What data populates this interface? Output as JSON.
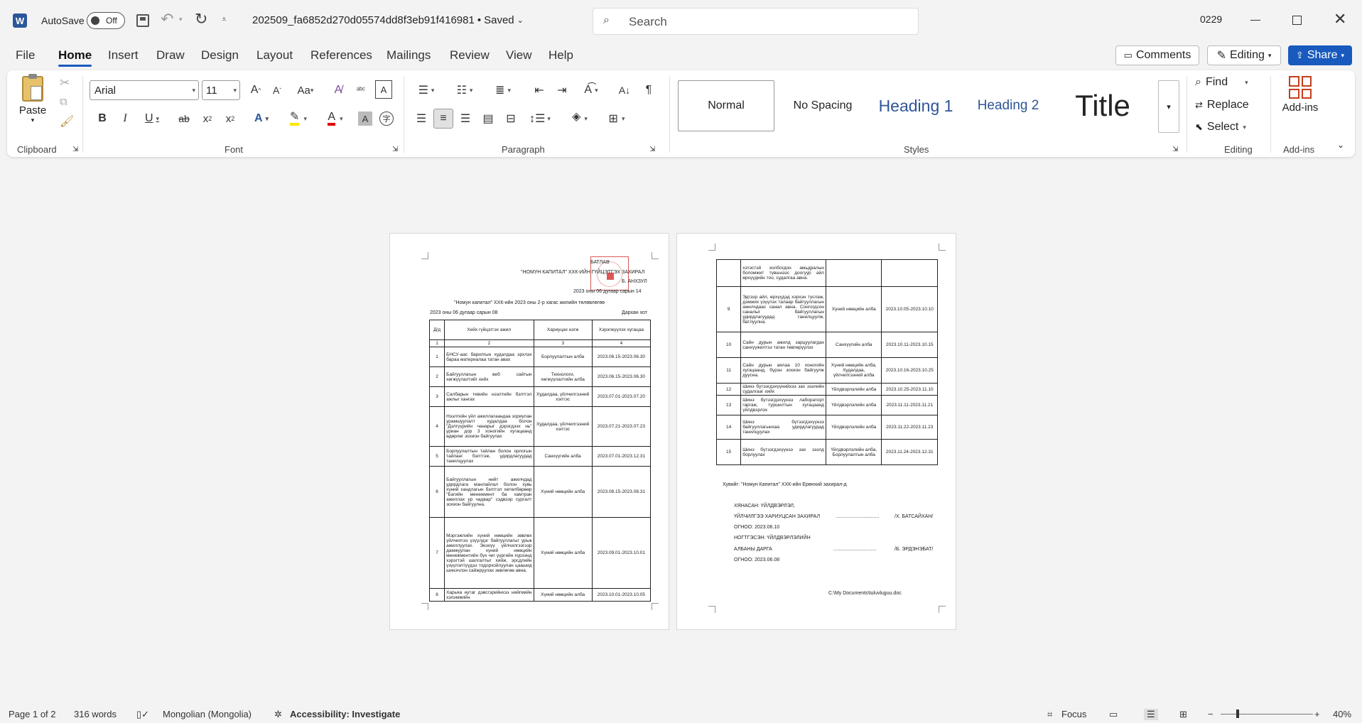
{
  "app": {
    "autosave": "AutoSave",
    "autosave_state": "Off",
    "filename": "202509_fa6852d270d05574dd8f3eb91f416981",
    "saved": "Saved",
    "search_placeholder": "Search",
    "user": "0229"
  },
  "tabs": [
    "File",
    "Home",
    "Insert",
    "Draw",
    "Design",
    "Layout",
    "References",
    "Mailings",
    "Review",
    "View",
    "Help"
  ],
  "right_buttons": {
    "comments": "Comments",
    "editing": "Editing",
    "share": "Share"
  },
  "ribbon": {
    "clipboard": {
      "paste": "Paste",
      "label": "Clipboard"
    },
    "font": {
      "name": "Arial",
      "size": "11",
      "label": "Font"
    },
    "paragraph": {
      "label": "Paragraph"
    },
    "styles": {
      "items": [
        "Normal",
        "No Spacing",
        "Heading 1",
        "Heading 2",
        "Title"
      ],
      "label": "Styles"
    },
    "editing": {
      "find": "Find",
      "replace": "Replace",
      "select": "Select",
      "label": "Editing"
    },
    "addins": {
      "btn": "Add-ins",
      "label": "Add-ins"
    }
  },
  "page1": {
    "approve": "БАТЛАВ",
    "approve_line2": "\"НОМУН КАПИТАЛ\" ХХК-ИЙН ГҮЙЦЭТГЭХ ЗАХИРАЛ",
    "approve_line3": "Б. АНХЗУЛ",
    "approve_date": "2023 оны 06 дугаар сарын 14",
    "title": "\"Номун капитал\" ХХК-ийн 2023 оны 2-р хагас жилийн төлөвлөгөө",
    "date_left": "2023 оны 06 дугаар сарын 08",
    "city": "Дархан хот",
    "headers": [
      "Д/д",
      "Хийх гүйцэтгэх ажил",
      "Хариуцах нэгж",
      "Хэрэгжүүлэх хугацаа"
    ],
    "nums": [
      "1",
      "2",
      "3",
      "4"
    ],
    "rows": [
      [
        "1",
        "БНСУ-аас барилгын худалдаа эрхлэх бараа материалаа татан авах",
        "Борлуулалтын алба",
        "2023.06.15-2023.06.30"
      ],
      [
        "2",
        "Байгууллагын веб сайтын хөгжүүлалтийг хийх",
        "Технологи, хөгжүүлалтийн алба",
        "2023.06.15-2023.06.30"
      ],
      [
        "3",
        "Салбарын тевийн нээлтийн бэлтгэл ажлыг хангах",
        "Худалдаа, үйлчилгээний хэлтэс",
        "2023.07.01-2023.07.20"
      ],
      [
        "4",
        "Нээлтийн үйл ажиллагаандаа зориулан урамшуулалт худалдаа болон \"Дэлгүүрийн чанарыг дэрэгдээх нь\" уриан дор 3 хоногийн хугацаанд өдөрлөг зохион байгуулах",
        "Худалдаа, үйлчилгээний хэлтэс",
        "2023.07.21-2023.07.23"
      ],
      [
        "5",
        "Борлуулалтын тайлан болон орлогын тайланг бэлтгэж, удирдлагуудад танилцуулах",
        "Санхүүгийн алба",
        "2023.07.01-2023.12.31"
      ],
      [
        "6",
        "Байгууллагын нийт ажилчдад удирдлага манлайлал болон хувь хүний хандлагын бэлтгэл хөтөлбөрөөр \"Багийн менежмент ба хамтран ажиллах ур чадвар\" сэдвээр сургалт зохион байгуулна.",
        "Хүний нөөцийн алба",
        "2023.08.15-2023.08.31"
      ],
      [
        "7",
        "Мэргэжлийн хүний нөөцийн зөвлөх үйлчилгээ үзүүлдэг байгууллагыг урьж ажиллуулах. Энэхүү үйлчилгээгээр дамжуулан хүний нөөцийн менежментийн бүх чиг үүргийн хүрээнд хэрэгтэй шалгалтыг хийж, эрсдлийн үзүүлэлтүүдээ тодорхойлуулан цаашид шинэчлэн сайжруулах зөвлөгөө авна.",
        "Хүний нөөцийн алба",
        "2023.09.01-2023.10.01"
      ],
      [
        "8",
        "Харьяа нутаг дэвсгэрийнхээ нийгмийн хэлэмжийн",
        "Хүний нөөцийн алба",
        "2023.10.01-2023.10.05"
      ]
    ]
  },
  "page2": {
    "rows": [
      [
        "",
        "хэтэстэй холбогдон амьдралын боломжит түвшнээс доогуур айл өрхүүдийн тоо, судалгаа авна.",
        "",
        ""
      ],
      [
        "9",
        "Эдгээр айл, өрхүүдэд хэрхэн туслаж, дэмжих үзүүлэх талаар байгууллагын ажилчдаас санал авна. Сонгогдсон саналыг байгууллагын удирдлагуудад танилцуулж, батлуулна.",
        "Хүний нөөцийн алба",
        "2023.10.05-2023.10.10"
      ],
      [
        "10",
        "Сайн дурын ажилд зарцуулагдах санхүүжилтээ татан төвлөрүүлэх",
        "Санхүүгийн алба",
        "2023.10.11-2023.10.15"
      ],
      [
        "11",
        "Сайн дурын аялаа 10 хоногийн хугацаанд, бүрэн зохион байгуулж дууcна.",
        "Хүний нөөцийн алба, Худалдаа, үйлчилгээний алба",
        "2023.10.16-2023.10.25"
      ],
      [
        "12",
        "Шинэ бүтээгдэхүүнийхээ зах зээлийн судалгааг хийх",
        "Үйлдвэрлэлийн алба",
        "2023.10.25-2023.11.10"
      ],
      [
        "13",
        "Шинэ бүтээгдэхүүнээ лабораторт гаргаж, туршилтын хугацаанд үйлдвэрлэх",
        "Үйлдвэрлэлийн алба",
        "2023.11.11-2023.11.21"
      ],
      [
        "14",
        "Шинэ бүтээгдэхүүнээ байгууллагынхаа удирдлагуудад танилцуулах",
        "Үйлдвэрлэлийн алба",
        "2023.11.22-2023.11.23"
      ],
      [
        "15",
        "Шинэ бүтээгдэхүүнээ зах зээлд борлуулах",
        "Үйлдвэрлэлийн алба, Борлуулалтын алба",
        "2023.11.24-2023.12.31"
      ]
    ],
    "copy": "Хувийг: \"Номун Капитал\" ХХК-ийн Ерөнхий захирал-д",
    "prepared": "ХЯНАСАН: ҮЙЛДВЭРЛЭЛ,",
    "prepared2": "ҮЙЛЧИЛГЭЭ ХАРИУЦСАН ЗАХИРАЛ",
    "prepared_sign": "/Х. БАТСАЙХАН/",
    "date1": "ОГНОО: 2023.06.10",
    "agreed": "НОГТГЭСЭН: ҮЙЛДВЭРЛЭЛИЙН",
    "agreed2": "АЛБАНЫ ДАРГА",
    "agreed_sign": "/Б. ЭРДЭНЭБАТ/",
    "date2": "ОГНОО: 2023.06.08",
    "dots": "...............................",
    "path": "C:\\My Documents\\tuluvluguu.doc"
  },
  "status": {
    "page": "Page 1 of 2",
    "words": "316 words",
    "lang": "Mongolian (Mongolia)",
    "access": "Accessibility: Investigate",
    "focus": "Focus",
    "zoom": "40%"
  },
  "colors": {
    "accent": "#185abd",
    "word_blue": "#2b579a",
    "stamp": "#d83a3a"
  }
}
